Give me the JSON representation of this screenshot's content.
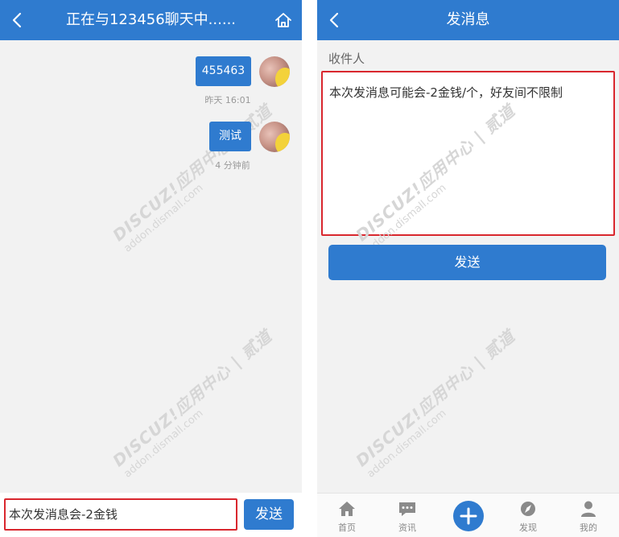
{
  "left_panel": {
    "header": {
      "title": "正在与123456聊天中......"
    },
    "messages": [
      {
        "text": "455463",
        "time": "昨天 16:01"
      },
      {
        "text": "测试",
        "time": "4 分钟前"
      }
    ],
    "composer": {
      "input_value": "本次发消息会-2金钱",
      "send_label": "发送"
    }
  },
  "right_panel": {
    "header": {
      "title": "发消息"
    },
    "recipient_label": "收件人",
    "message_value": "本次发消息可能会-2金钱/个，好友间不限制",
    "send_label": "发送",
    "tabbar": [
      {
        "label": "首页",
        "icon": "home-icon"
      },
      {
        "label": "资讯",
        "icon": "chat-icon"
      },
      {
        "label": "",
        "icon": "plus-icon"
      },
      {
        "label": "发现",
        "icon": "compass-icon"
      },
      {
        "label": "我的",
        "icon": "user-icon"
      }
    ]
  },
  "watermark": {
    "line1": "DISCUZ!应用中心 | 贰道",
    "line2": "addon.dismall.com"
  },
  "colors": {
    "accent": "#2f7bcf",
    "highlight_border": "#d9272e",
    "background": "#f2f2f2"
  }
}
